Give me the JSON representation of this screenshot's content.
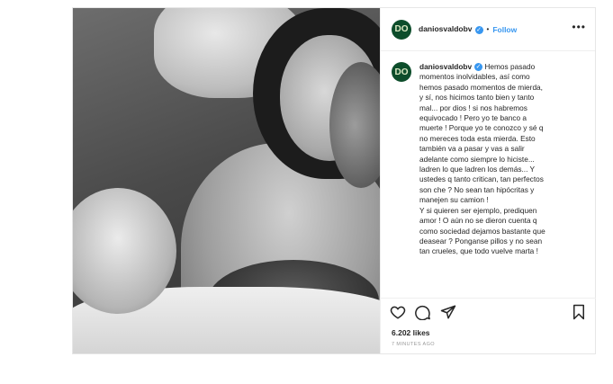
{
  "post": {
    "photo_alt": "",
    "header": {
      "avatar_initials": "DO",
      "username": "daniosvaldobv",
      "verified_mark": "✓",
      "separator": "•",
      "follow_label": "Follow",
      "more_label": "•••"
    },
    "caption": {
      "username": "daniosvaldobv",
      "verified_mark": "✓",
      "text": "Hemos pasado\nmomentos inolvidables, así como\nhemos pasado momentos de mierda,\ny sí, nos hicimos tanto bien y tanto\nmal... por dios ! si nos habremos\nequivocado ! Pero yo te banco a\nmuerte ! Porque yo te conozco y sé q\nno mereces toda esta mierda. Esto\ntambién va a pasar y vas a salir\nadelante como siempre lo hiciste...\nladren lo que ladren los demás... Y\nustedes q tanto critican, tan perfectos\nson che ? No sean tan hipócritas y\nmanejen su camion !\nY si quieren ser ejemplo, prediquen\namor ! O aún no se dieron cuenta q\ncomo sociedad dejamos bastante que\ndeasear ? Ponganse pillos y no sean\ntan crueles, que todo vuelve marta !"
    },
    "actions": {
      "like_icon": "heart-icon",
      "comment_icon": "comment-icon",
      "share_icon": "share-icon",
      "save_icon": "bookmark-icon"
    },
    "likes": "6.202 likes",
    "timestamp": "7 MINUTES AGO"
  },
  "colors": {
    "accent": "#3897f0",
    "avatar_bg": "#0d4d2b",
    "text": "#262626",
    "muted": "#999999"
  }
}
